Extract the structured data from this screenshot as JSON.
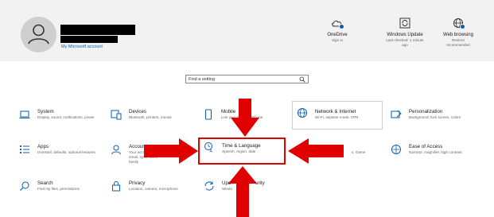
{
  "header": {
    "account_link": "My Microsoft account",
    "tiles": [
      {
        "title": "OneDrive",
        "sub": "Sign in",
        "icon": "onedrive-icon"
      },
      {
        "title": "Windows Update",
        "sub": "Last checked: 1 minute ago",
        "icon": "windows-update-icon"
      },
      {
        "title": "Web browsing",
        "sub": "Restore recommended",
        "icon": "web-browsing-icon"
      }
    ]
  },
  "search": {
    "placeholder": "Find a setting"
  },
  "categories": [
    {
      "title": "System",
      "desc": "Display, sound, notifications, power",
      "icon": "laptop-icon"
    },
    {
      "title": "Devices",
      "desc": "Bluetooth, printers, mouse",
      "icon": "devices-icon"
    },
    {
      "title": "Mobile",
      "desc": "Link your Android, iPhone",
      "icon": "phone-icon"
    },
    {
      "title": "Network & Internet",
      "desc": "Wi-Fi, airplane mode, VPN",
      "icon": "globe-icon"
    },
    {
      "title": "Personalization",
      "desc": "Background, lock screen, colors",
      "icon": "personalization-icon"
    },
    {
      "title": "Apps",
      "desc": "Uninstall, defaults, optional features",
      "icon": "apps-icon"
    },
    {
      "title": "Accounts",
      "desc": "Your accounts, email, sync, work, family",
      "icon": "accounts-icon"
    },
    {
      "title": "Time & Language",
      "desc": "Speech, region, date",
      "icon": "time-language-icon"
    },
    {
      "title": "",
      "desc": "s, Game",
      "icon": "gaming-icon"
    },
    {
      "title": "Ease of Access",
      "desc": "Narrator, magnifier, high contrast",
      "icon": "ease-of-access-icon"
    },
    {
      "title": "Search",
      "desc": "Find my files, permissions",
      "icon": "search-icon"
    },
    {
      "title": "Privacy",
      "desc": "Location, camera, microphone",
      "icon": "lock-icon"
    },
    {
      "title": "Upd",
      "desc": "Windo",
      "title_end": "urity",
      "icon": "update-security-icon"
    }
  ],
  "accent_color": "#0a5fb4",
  "highlight_color": "#e00000"
}
